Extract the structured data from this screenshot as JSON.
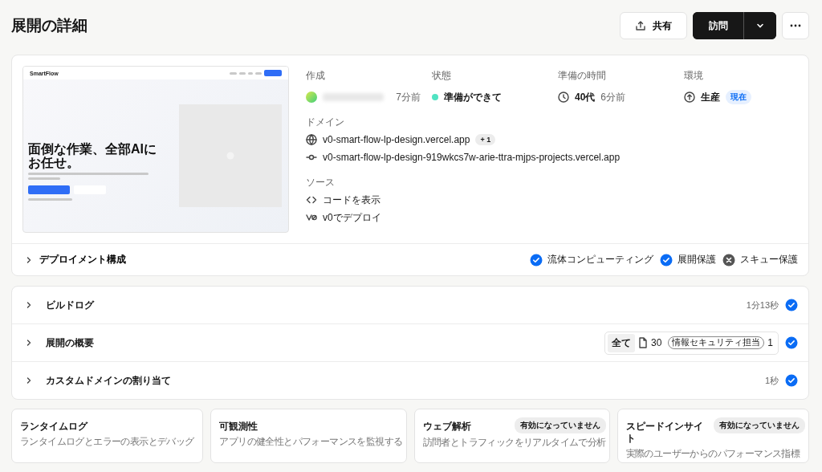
{
  "title": "展開の詳細",
  "share_button": "共有",
  "visit_button": "訪問",
  "preview": {
    "brand": "SmartFlow",
    "headline": "面倒な作業、全部AIにお任せ。"
  },
  "created": {
    "label": "作成",
    "time": "7分前"
  },
  "status": {
    "label": "状態",
    "value": "準備ができて",
    "color": "#50e3c2"
  },
  "ready_time": {
    "label": "準備の時間",
    "value": "40代",
    "ago": "6分前"
  },
  "environment": {
    "label": "環境",
    "value": "生産",
    "badge": "現在"
  },
  "domains": {
    "label": "ドメイン",
    "items": [
      {
        "kind": "primary",
        "url": "v0-smart-flow-lp-design.vercel.app",
        "extra": "+ 1"
      },
      {
        "kind": "branch",
        "url": "v0-smart-flow-lp-design-919wkcs7w-arie-ttra-mjps-projects.vercel.app"
      }
    ]
  },
  "source": {
    "label": "ソース",
    "items": [
      {
        "kind": "code",
        "text": "コードを表示"
      },
      {
        "kind": "v0",
        "text": "v0でデプロイ"
      }
    ]
  },
  "config": {
    "label": "デプロイメント構成",
    "expanded": false,
    "features": [
      {
        "label": "流体コンピューティング",
        "enabled": true
      },
      {
        "label": "展開保護",
        "enabled": true
      },
      {
        "label": "スキュー保護",
        "enabled": false
      }
    ]
  },
  "steps": [
    {
      "kind": "duration",
      "label": "ビルドログ",
      "expanded": false,
      "duration": "1分13秒",
      "done": true
    },
    {
      "kind": "summary",
      "label": "展開の概要",
      "expanded": false,
      "filter": "全て",
      "files": "30",
      "tag": "情報セキュリティ担当",
      "tag_count": "1",
      "done": true
    },
    {
      "kind": "duration",
      "label": "カスタムドメインの割り当て",
      "expanded": false,
      "duration": "1秒",
      "done": true
    }
  ],
  "tools": [
    {
      "title": "ランタイムログ",
      "description": "ランタイムログとエラーの表示とデバッグ"
    },
    {
      "title": "可観測性",
      "description": "アプリの健全性とパフォーマンスを監視する"
    },
    {
      "title": "ウェブ解析",
      "description": "訪問者とトラフィックをリアルタイムで分析",
      "badge": "有効になっていません"
    },
    {
      "title": "スピードインサイト",
      "description": "実際のユーザーからのパフォーマンス指標",
      "badge": "有効になっていません"
    }
  ]
}
